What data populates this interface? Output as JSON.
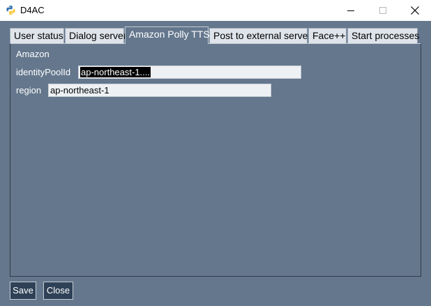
{
  "window": {
    "title": "D4AC",
    "controls": {
      "minimize_icon": "minimize-icon",
      "maximize_icon": "maximize-icon",
      "close_icon": "close-icon"
    }
  },
  "tabs": [
    {
      "label": "User status"
    },
    {
      "label": "Dialog server"
    },
    {
      "label": "Amazon Polly TTS",
      "active": true
    },
    {
      "label": "Post to external server"
    },
    {
      "label": "Face++"
    },
    {
      "label": "Start processes"
    }
  ],
  "panel": {
    "section_label": "Amazon",
    "identity_pool": {
      "label": "identityPoolId",
      "value": "ap-northeast-1...."
    },
    "region": {
      "label": "region",
      "value": "ap-northeast-1"
    }
  },
  "buttons": {
    "save_label": "Save",
    "close_label": "Close"
  },
  "colors": {
    "background": "#64778d",
    "button": "#2e4157",
    "field": "#eef1f4"
  }
}
